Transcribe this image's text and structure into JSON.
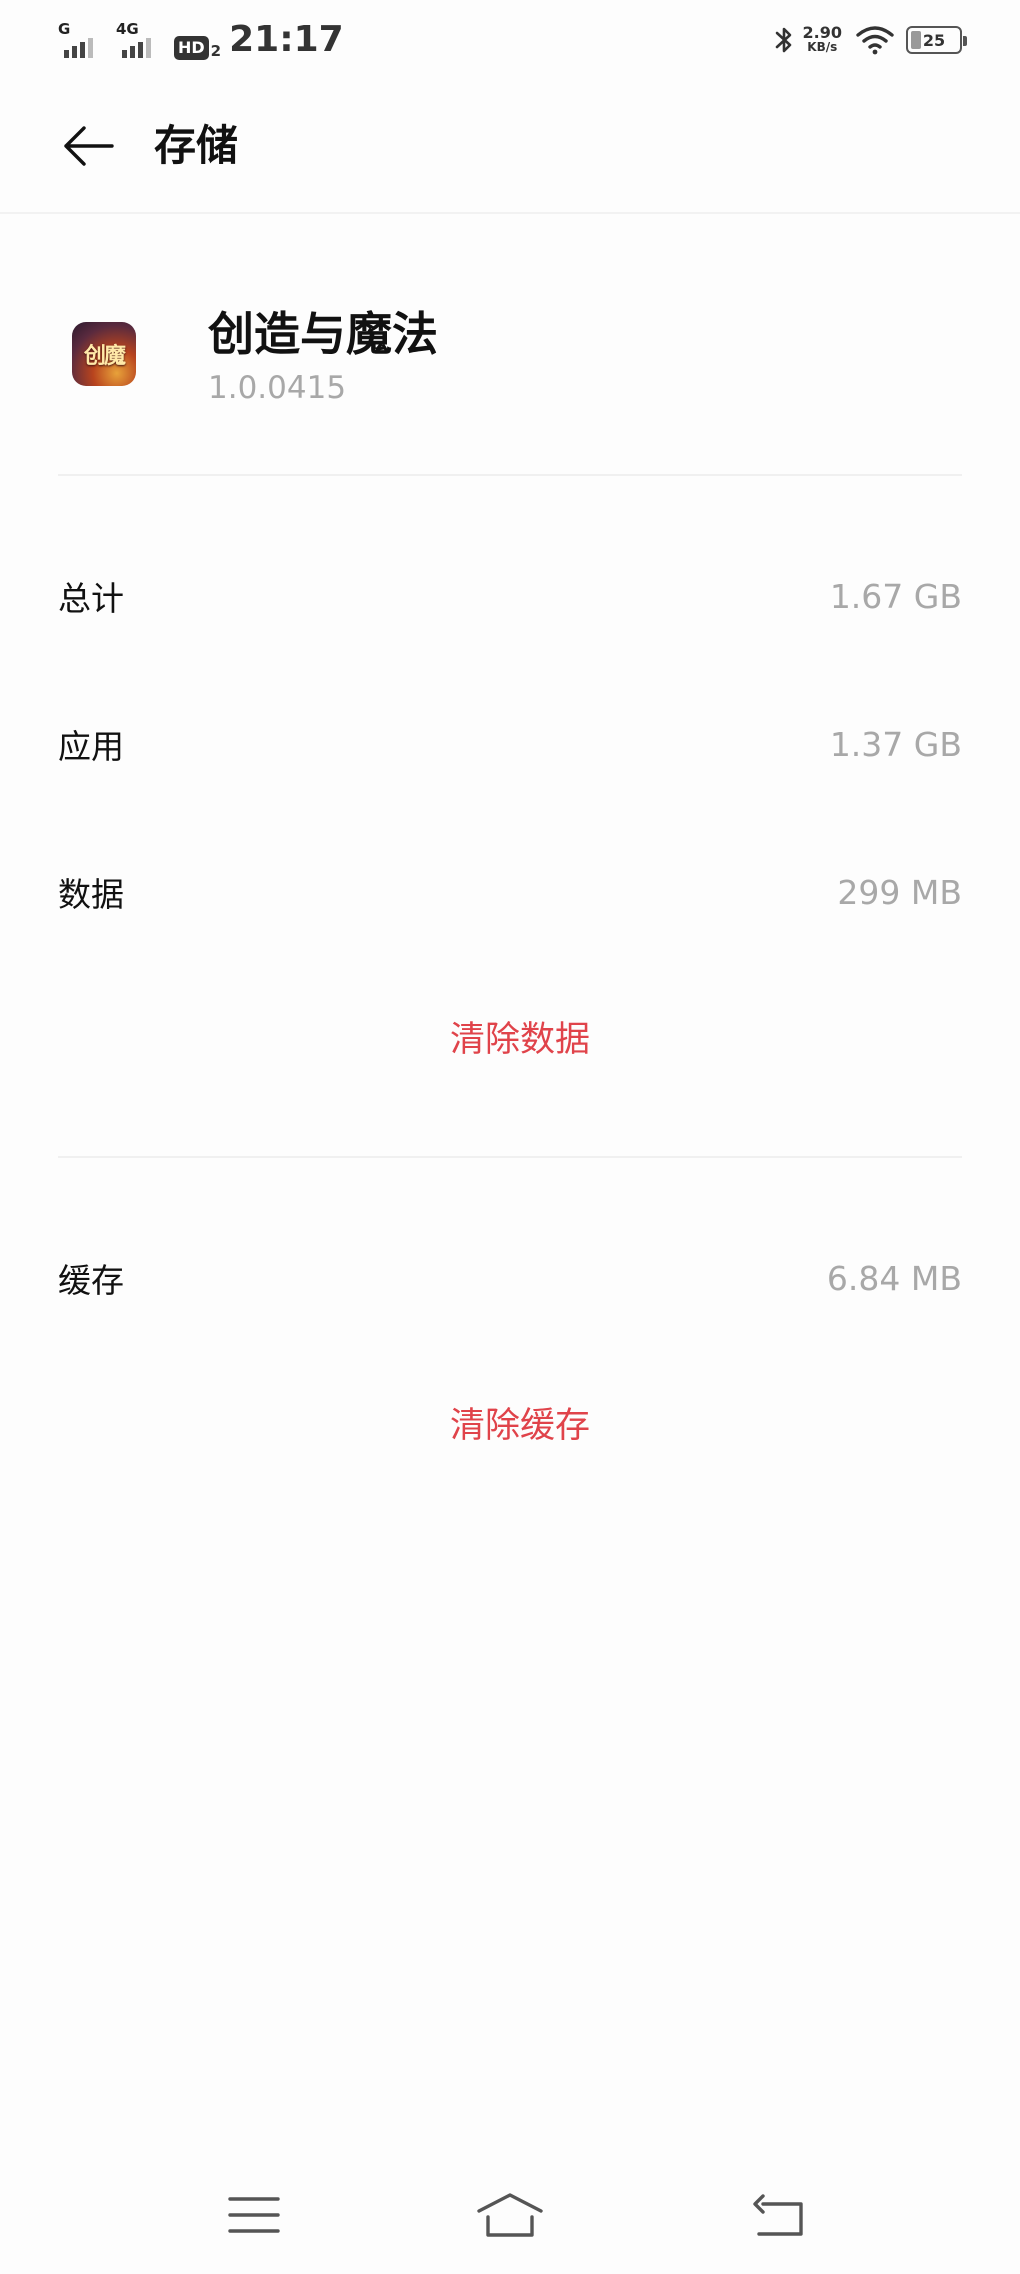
{
  "status_bar": {
    "sim1_network": "G",
    "sim2_network": "4G",
    "hd_label": "HD",
    "hd_sub": "2",
    "time": "21:17",
    "net_speed_value": "2.90",
    "net_speed_unit": "KB/s",
    "battery_level": "25",
    "icons": [
      "signal-icon",
      "signal-icon",
      "hd-voice-icon",
      "bluetooth-icon",
      "wifi-icon",
      "battery-icon"
    ]
  },
  "header": {
    "title": "存储",
    "back_icon": "arrow-left-icon"
  },
  "app": {
    "name": "创造与魔法",
    "version": "1.0.0415",
    "icon_text": "创魔"
  },
  "storage": {
    "rows": [
      {
        "label": "总计",
        "value": "1.67 GB"
      },
      {
        "label": "应用",
        "value": "1.37 GB"
      },
      {
        "label": "数据",
        "value": "299 MB"
      }
    ],
    "clear_data_label": "清除数据",
    "cache_label": "缓存",
    "cache_value": "6.84 MB",
    "clear_cache_label": "清除缓存"
  },
  "colors": {
    "accent": "#e0434a",
    "secondary_text": "#a8a8a8",
    "background": "#fdfdfd"
  },
  "nav_bar": {
    "icons": [
      "menu-icon",
      "home-icon",
      "back-icon"
    ]
  }
}
